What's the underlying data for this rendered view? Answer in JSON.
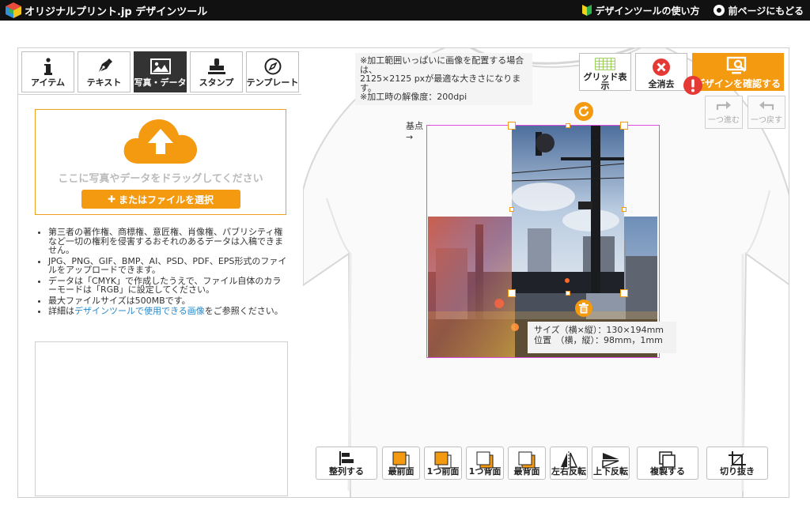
{
  "header": {
    "logo_text": "オリジナルプリント.jp デザインツール",
    "how_to_label": "デザインツールの使い方",
    "back_label": "前ページにもどる"
  },
  "left_panel": {
    "tabs": [
      {
        "label": "アイテム",
        "icon": "info-icon"
      },
      {
        "label": "テキスト",
        "icon": "pen-icon"
      },
      {
        "label": "写真・データ",
        "icon": "image-icon",
        "active": true
      },
      {
        "label": "スタンプ",
        "icon": "stamp-icon"
      },
      {
        "label": "テンプレート",
        "icon": "compass-icon"
      }
    ],
    "drop_text": "ここに写真やデータをドラッグしてください",
    "select_file_label": "またはファイルを選択",
    "notes": [
      "第三者の著作権、商標権、意匠権、肖像権、パブリシティ権など一切の権利を侵害するおそれのあるデータは入稿できません。",
      "JPG、PNG、GIF、BMP、AI、PSD、PDF、EPS形式のファイルをアップロードできます。",
      "データは「CMYK」で作成したうえで、ファイル自体のカラーモードは「RGB」に設定してください。",
      "最大ファイルサイズは500MBです。"
    ],
    "note_last_prefix": "詳細は",
    "note_last_link": "デザインツールで使用できる画像",
    "note_last_suffix": "をご参照ください。"
  },
  "canvas": {
    "info_lines": [
      "※加工範囲いっぱいに画像を配置する場合は、",
      "2125×2125 pxが最適な大きさになります。",
      "※加工時の解像度：200dpi"
    ],
    "grid_label": "グリッド表示",
    "clear_label": "全消去",
    "confirm_label": "デザインを確認する",
    "redo_label": "一つ進む",
    "undo_label": "一つ戻す",
    "base_point_label": "基点",
    "size_line": "サイズ（横×縦）：130×194mm",
    "position_line": "位置　（横，縦）：98mm，1mm"
  },
  "bottom_toolbar": [
    {
      "label": "整列する",
      "icon": "align-icon"
    },
    {
      "label": "最前面",
      "icon": "bring-front-icon"
    },
    {
      "label": "1つ前面",
      "icon": "bring-forward-icon"
    },
    {
      "label": "1つ背面",
      "icon": "send-backward-icon"
    },
    {
      "label": "最背面",
      "icon": "send-back-icon"
    },
    {
      "label": "左右反転",
      "icon": "flip-horizontal-icon"
    },
    {
      "label": "上下反転",
      "icon": "flip-vertical-icon"
    },
    {
      "label": "複製する",
      "icon": "duplicate-icon"
    },
    {
      "label": "切り抜き",
      "icon": "crop-icon"
    }
  ],
  "colors": {
    "accent": "#f39a11",
    "print_area": "#e04ee0",
    "header_bg": "#111111",
    "link": "#2a88c9"
  }
}
